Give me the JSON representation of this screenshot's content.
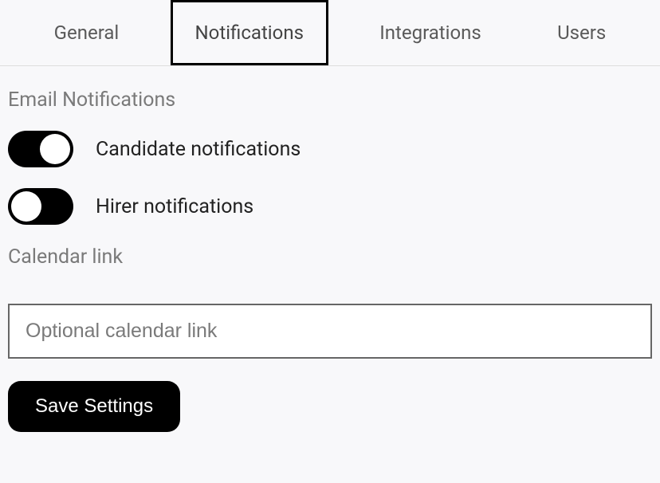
{
  "tabs": {
    "general": "General",
    "notifications": "Notifications",
    "integrations": "Integrations",
    "users": "Users"
  },
  "sections": {
    "email_title": "Email Notifications",
    "calendar_title": "Calendar link"
  },
  "toggles": {
    "candidate": {
      "label": "Candidate notifications",
      "state": "on"
    },
    "hirer": {
      "label": "Hirer notifications",
      "state": "off"
    }
  },
  "inputs": {
    "calendar_placeholder": "Optional calendar link",
    "calendar_value": ""
  },
  "buttons": {
    "save": "Save Settings"
  }
}
